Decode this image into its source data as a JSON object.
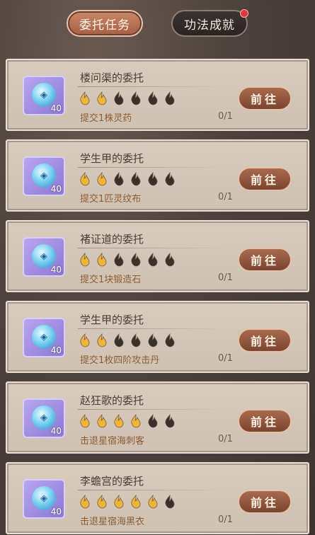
{
  "tabs": {
    "active_label": "委托任务",
    "inactive_label": "功法成就"
  },
  "colors": {
    "flame_lit": "#f1b536",
    "flame_unlit": "#3a302b",
    "button": "#8f5438",
    "notification_dot": "#e0383a"
  },
  "quests": [
    {
      "title": "楼问渠的委托",
      "desc": "提交1株灵药",
      "progress": "0/1",
      "button": "前往",
      "item_count": "40",
      "item_icon": "blue-orb-icon",
      "difficulty": 2,
      "max": 6
    },
    {
      "title": "学生甲的委托",
      "desc": "提交1匹灵纹布",
      "progress": "0/1",
      "button": "前往",
      "item_count": "40",
      "item_icon": "blue-orb-icon",
      "difficulty": 2,
      "max": 6
    },
    {
      "title": "褚证道的委托",
      "desc": "提交1块锻造石",
      "progress": "0/1",
      "button": "前往",
      "item_count": "40",
      "item_icon": "blue-orb-icon",
      "difficulty": 2,
      "max": 6
    },
    {
      "title": "学生甲的委托",
      "desc": "提交1枚四阶攻击丹",
      "progress": "0/1",
      "button": "前往",
      "item_count": "40",
      "item_icon": "blue-orb-icon",
      "difficulty": 2,
      "max": 6
    },
    {
      "title": "赵狂歌的委托",
      "desc": "击退星宿海刺客",
      "progress": "0/1",
      "button": "前往",
      "item_count": "40",
      "item_icon": "blue-orb-icon",
      "difficulty": 4,
      "max": 6
    },
    {
      "title": "李蟾宫的委托",
      "desc": "击退星宿海黑衣",
      "progress": "0/1",
      "button": "前往",
      "item_count": "40",
      "item_icon": "blue-orb-icon",
      "difficulty": 5,
      "max": 6
    }
  ]
}
